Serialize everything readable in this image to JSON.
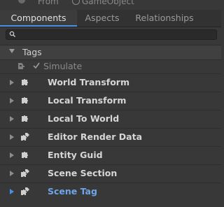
{
  "top": {
    "from_label": "From",
    "source_label": "GameObject"
  },
  "tabs": [
    {
      "label": "Components",
      "active": true
    },
    {
      "label": "Aspects",
      "active": false
    },
    {
      "label": "Relationships",
      "active": false
    }
  ],
  "search": {
    "value": ""
  },
  "tags": {
    "header": "Tags",
    "items": [
      {
        "label": "Simulate",
        "checked": true
      }
    ]
  },
  "components": [
    {
      "label": "World Transform",
      "icon": "puzzle-icon",
      "selected": false
    },
    {
      "label": "Local Transform",
      "icon": "puzzle-icon",
      "selected": false
    },
    {
      "label": "Local To World",
      "icon": "puzzle-icon",
      "selected": false
    },
    {
      "label": "Editor Render Data",
      "icon": "shared-puzzle-icon",
      "selected": false
    },
    {
      "label": "Entity Guid",
      "icon": "puzzle-icon",
      "selected": false
    },
    {
      "label": "Scene Section",
      "icon": "shared-puzzle-icon",
      "selected": false
    },
    {
      "label": "Scene Tag",
      "icon": "shared-puzzle-icon",
      "selected": true
    }
  ],
  "colors": {
    "accent": "#4a90e2",
    "background": "#383838",
    "selected_text": "#6fa5e8"
  }
}
